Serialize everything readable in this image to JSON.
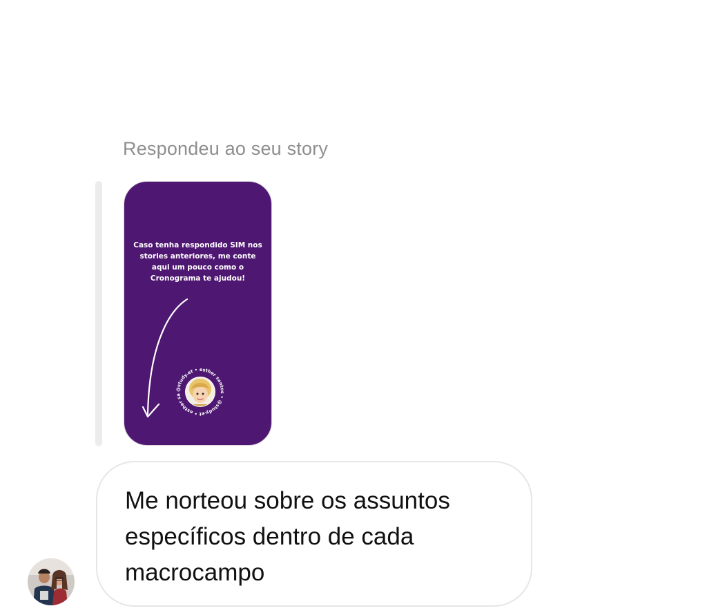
{
  "thread": {
    "reply_caption": "Respondeu ao seu story"
  },
  "story": {
    "text": "Caso tenha respondido SIM nos stories anteriores, me conte aqui um pouco como o Cronograma te ajudou!",
    "sticker_ring_text": "@study.et • esther santos • @study.et • esther santos •",
    "background_color": "#4e1771"
  },
  "message": {
    "text": "Me norteou sobre os assuntos específicos dentro de cada macrocampo"
  },
  "sender": {
    "avatar_icon": "sender-avatar-photo"
  }
}
